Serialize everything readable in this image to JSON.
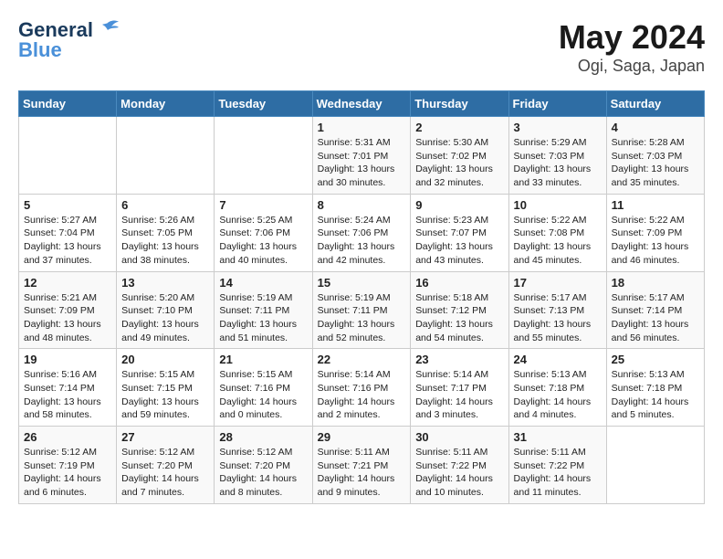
{
  "logo": {
    "general": "General",
    "blue": "Blue",
    "tagline": ""
  },
  "header": {
    "title": "May 2024",
    "subtitle": "Ogi, Saga, Japan"
  },
  "weekdays": [
    "Sunday",
    "Monday",
    "Tuesday",
    "Wednesday",
    "Thursday",
    "Friday",
    "Saturday"
  ],
  "weeks": [
    [
      {
        "day": "",
        "info": ""
      },
      {
        "day": "",
        "info": ""
      },
      {
        "day": "",
        "info": ""
      },
      {
        "day": "1",
        "info": "Sunrise: 5:31 AM\nSunset: 7:01 PM\nDaylight: 13 hours\nand 30 minutes."
      },
      {
        "day": "2",
        "info": "Sunrise: 5:30 AM\nSunset: 7:02 PM\nDaylight: 13 hours\nand 32 minutes."
      },
      {
        "day": "3",
        "info": "Sunrise: 5:29 AM\nSunset: 7:03 PM\nDaylight: 13 hours\nand 33 minutes."
      },
      {
        "day": "4",
        "info": "Sunrise: 5:28 AM\nSunset: 7:03 PM\nDaylight: 13 hours\nand 35 minutes."
      }
    ],
    [
      {
        "day": "5",
        "info": "Sunrise: 5:27 AM\nSunset: 7:04 PM\nDaylight: 13 hours\nand 37 minutes."
      },
      {
        "day": "6",
        "info": "Sunrise: 5:26 AM\nSunset: 7:05 PM\nDaylight: 13 hours\nand 38 minutes."
      },
      {
        "day": "7",
        "info": "Sunrise: 5:25 AM\nSunset: 7:06 PM\nDaylight: 13 hours\nand 40 minutes."
      },
      {
        "day": "8",
        "info": "Sunrise: 5:24 AM\nSunset: 7:06 PM\nDaylight: 13 hours\nand 42 minutes."
      },
      {
        "day": "9",
        "info": "Sunrise: 5:23 AM\nSunset: 7:07 PM\nDaylight: 13 hours\nand 43 minutes."
      },
      {
        "day": "10",
        "info": "Sunrise: 5:22 AM\nSunset: 7:08 PM\nDaylight: 13 hours\nand 45 minutes."
      },
      {
        "day": "11",
        "info": "Sunrise: 5:22 AM\nSunset: 7:09 PM\nDaylight: 13 hours\nand 46 minutes."
      }
    ],
    [
      {
        "day": "12",
        "info": "Sunrise: 5:21 AM\nSunset: 7:09 PM\nDaylight: 13 hours\nand 48 minutes."
      },
      {
        "day": "13",
        "info": "Sunrise: 5:20 AM\nSunset: 7:10 PM\nDaylight: 13 hours\nand 49 minutes."
      },
      {
        "day": "14",
        "info": "Sunrise: 5:19 AM\nSunset: 7:11 PM\nDaylight: 13 hours\nand 51 minutes."
      },
      {
        "day": "15",
        "info": "Sunrise: 5:19 AM\nSunset: 7:11 PM\nDaylight: 13 hours\nand 52 minutes."
      },
      {
        "day": "16",
        "info": "Sunrise: 5:18 AM\nSunset: 7:12 PM\nDaylight: 13 hours\nand 54 minutes."
      },
      {
        "day": "17",
        "info": "Sunrise: 5:17 AM\nSunset: 7:13 PM\nDaylight: 13 hours\nand 55 minutes."
      },
      {
        "day": "18",
        "info": "Sunrise: 5:17 AM\nSunset: 7:14 PM\nDaylight: 13 hours\nand 56 minutes."
      }
    ],
    [
      {
        "day": "19",
        "info": "Sunrise: 5:16 AM\nSunset: 7:14 PM\nDaylight: 13 hours\nand 58 minutes."
      },
      {
        "day": "20",
        "info": "Sunrise: 5:15 AM\nSunset: 7:15 PM\nDaylight: 13 hours\nand 59 minutes."
      },
      {
        "day": "21",
        "info": "Sunrise: 5:15 AM\nSunset: 7:16 PM\nDaylight: 14 hours\nand 0 minutes."
      },
      {
        "day": "22",
        "info": "Sunrise: 5:14 AM\nSunset: 7:16 PM\nDaylight: 14 hours\nand 2 minutes."
      },
      {
        "day": "23",
        "info": "Sunrise: 5:14 AM\nSunset: 7:17 PM\nDaylight: 14 hours\nand 3 minutes."
      },
      {
        "day": "24",
        "info": "Sunrise: 5:13 AM\nSunset: 7:18 PM\nDaylight: 14 hours\nand 4 minutes."
      },
      {
        "day": "25",
        "info": "Sunrise: 5:13 AM\nSunset: 7:18 PM\nDaylight: 14 hours\nand 5 minutes."
      }
    ],
    [
      {
        "day": "26",
        "info": "Sunrise: 5:12 AM\nSunset: 7:19 PM\nDaylight: 14 hours\nand 6 minutes."
      },
      {
        "day": "27",
        "info": "Sunrise: 5:12 AM\nSunset: 7:20 PM\nDaylight: 14 hours\nand 7 minutes."
      },
      {
        "day": "28",
        "info": "Sunrise: 5:12 AM\nSunset: 7:20 PM\nDaylight: 14 hours\nand 8 minutes."
      },
      {
        "day": "29",
        "info": "Sunrise: 5:11 AM\nSunset: 7:21 PM\nDaylight: 14 hours\nand 9 minutes."
      },
      {
        "day": "30",
        "info": "Sunrise: 5:11 AM\nSunset: 7:22 PM\nDaylight: 14 hours\nand 10 minutes."
      },
      {
        "day": "31",
        "info": "Sunrise: 5:11 AM\nSunset: 7:22 PM\nDaylight: 14 hours\nand 11 minutes."
      },
      {
        "day": "",
        "info": ""
      }
    ]
  ]
}
